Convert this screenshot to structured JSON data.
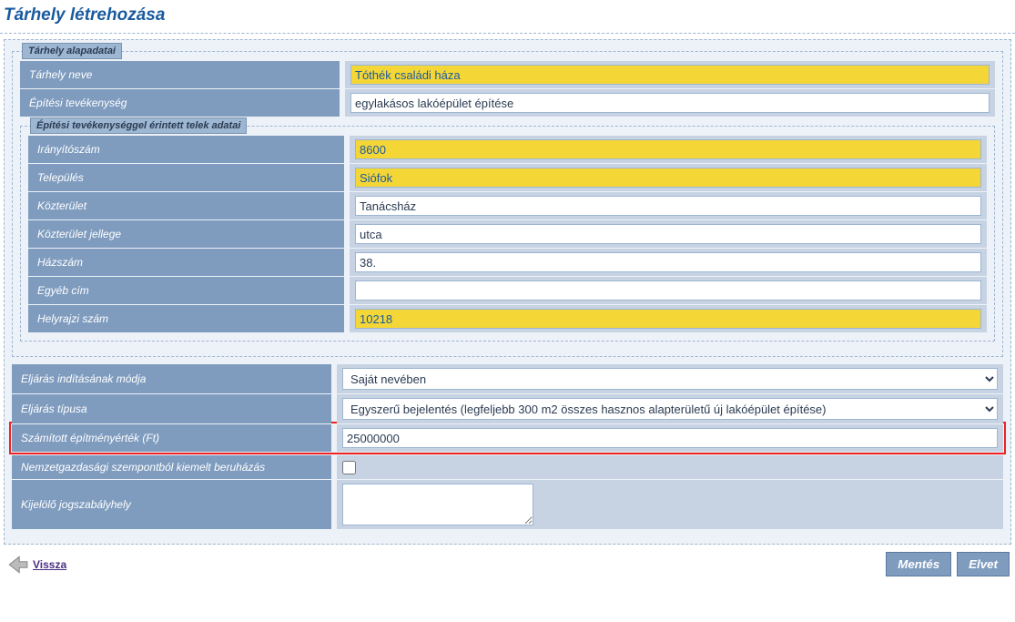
{
  "title": "Tárhely létrehozása",
  "fs_main_legend": "Tárhely alapadatai",
  "fs_plot_legend": "Építési tevékenységgel érintett telek adatai",
  "labels": {
    "name": "Tárhely neve",
    "activity": "Építési tevékenység",
    "zip": "Irányítószám",
    "city": "Település",
    "street": "Közterület",
    "street_type": "Közterület jellege",
    "house_no": "Házszám",
    "other_addr": "Egyéb cím",
    "lot_no": "Helyrajzi szám",
    "proc_mode": "Eljárás indításának módja",
    "proc_type": "Eljárás típusa",
    "calc_value": "Számított építményérték (Ft)",
    "priority": "Nemzetgazdasági szempontból kiemelt beruházás",
    "law_ref": "Kijelölő jogszabályhely"
  },
  "values": {
    "name": "Tóthék családi háza",
    "activity": "egylakásos lakóépület építése",
    "zip": "8600",
    "city": "Siófok",
    "street": "Tanácsház",
    "street_type": "utca",
    "house_no": "38.",
    "other_addr": "",
    "lot_no": "10218",
    "proc_mode": "Saját nevében",
    "proc_type": "Egyszerű bejelentés (legfeljebb 300 m2 összes hasznos alapterületű új lakóépület építése)",
    "calc_value": "25000000",
    "priority": false,
    "law_ref": ""
  },
  "footer": {
    "back": "Vissza",
    "save": "Mentés",
    "discard": "Elvet"
  }
}
